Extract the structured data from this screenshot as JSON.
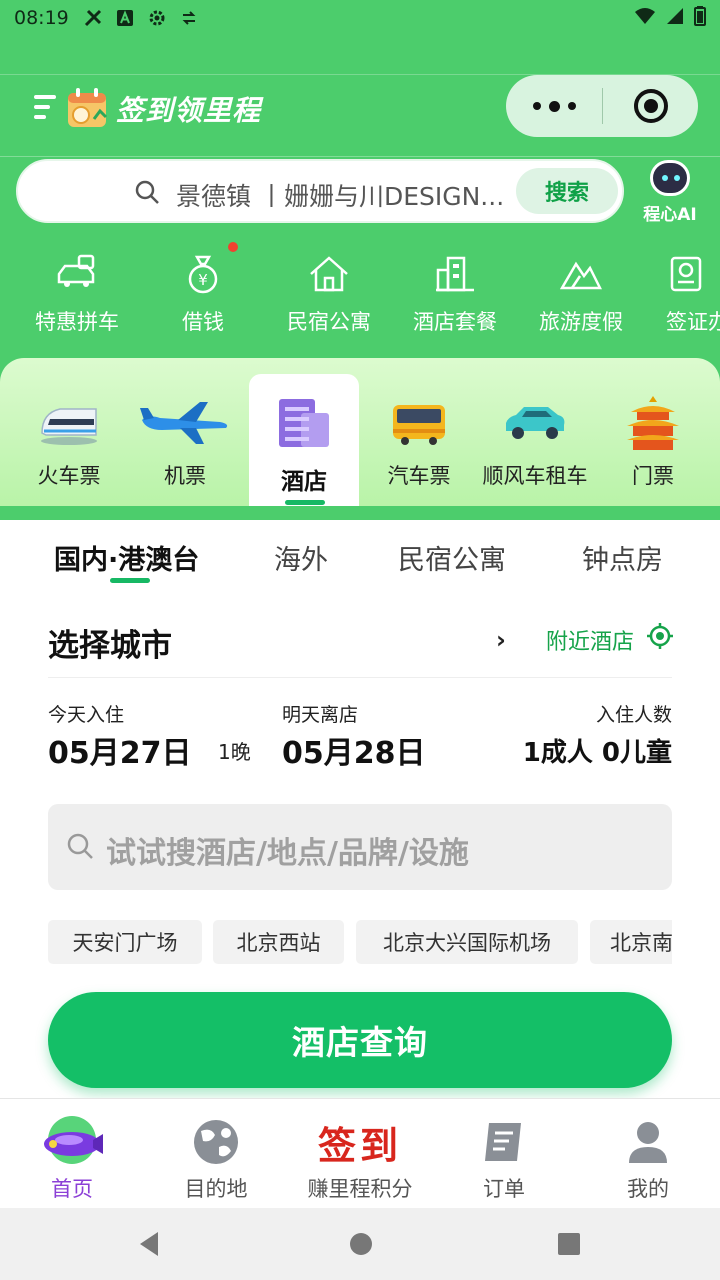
{
  "status_bar": {
    "time": "08:19"
  },
  "titlebar": {
    "title": "签到领里程"
  },
  "search": {
    "text": "景德镇 丨姗姗与川DESIGN...",
    "button": "搜索"
  },
  "ai": {
    "label": "程心AI"
  },
  "services": [
    {
      "label": "特惠拼车",
      "icon": "car-share-icon"
    },
    {
      "label": "借钱",
      "icon": "money-bag-icon",
      "badge": true
    },
    {
      "label": "民宿公寓",
      "icon": "house-icon"
    },
    {
      "label": "酒店套餐",
      "icon": "hotel-building-icon"
    },
    {
      "label": "旅游度假",
      "icon": "mountain-icon"
    },
    {
      "label": "签证办",
      "icon": "passport-icon"
    }
  ],
  "categories": [
    {
      "label": "火车票",
      "icon": "train-icon"
    },
    {
      "label": "机票",
      "icon": "airplane-icon"
    },
    {
      "label": "酒店",
      "icon": "hotel-icon",
      "active": true
    },
    {
      "label": "汽车票",
      "icon": "bus-icon"
    },
    {
      "label": "顺风车租车",
      "icon": "car-icon"
    },
    {
      "label": "门票",
      "icon": "temple-icon"
    }
  ],
  "sub_tabs": [
    {
      "label": "国内·港澳台",
      "active": true
    },
    {
      "label": "海外"
    },
    {
      "label": "民宿公寓"
    },
    {
      "label": "钟点房"
    }
  ],
  "city": {
    "title": "选择城市",
    "arrow": "›",
    "nearby": "附近酒店"
  },
  "dates": {
    "checkin_label": "今天入住",
    "checkin": "05月27日",
    "nights": "1晚",
    "checkout_label": "明天离店",
    "checkout": "05月28日",
    "guests_label": "入住人数",
    "guests": "1成人 0儿童"
  },
  "hotel_search": {
    "placeholder": "试试搜酒店/地点/品牌/设施"
  },
  "chips": [
    "天安门广场",
    "北京西站",
    "北京大兴国际机场",
    "北京南"
  ],
  "query_button": "酒店查询",
  "bottom_nav": [
    {
      "label": "首页",
      "icon": "blimp-home-icon",
      "active": true
    },
    {
      "label": "目的地",
      "icon": "globe-icon"
    },
    {
      "label": "赚里程积分",
      "icon": "sign-in-icon",
      "art": "签到"
    },
    {
      "label": "订单",
      "icon": "order-icon"
    },
    {
      "label": "我的",
      "icon": "profile-icon"
    }
  ],
  "colors": {
    "brand_green": "#4ccd6c",
    "button_green": "#14bf67",
    "nav_active": "#8b3fd6",
    "accent_red": "#d8261d"
  }
}
